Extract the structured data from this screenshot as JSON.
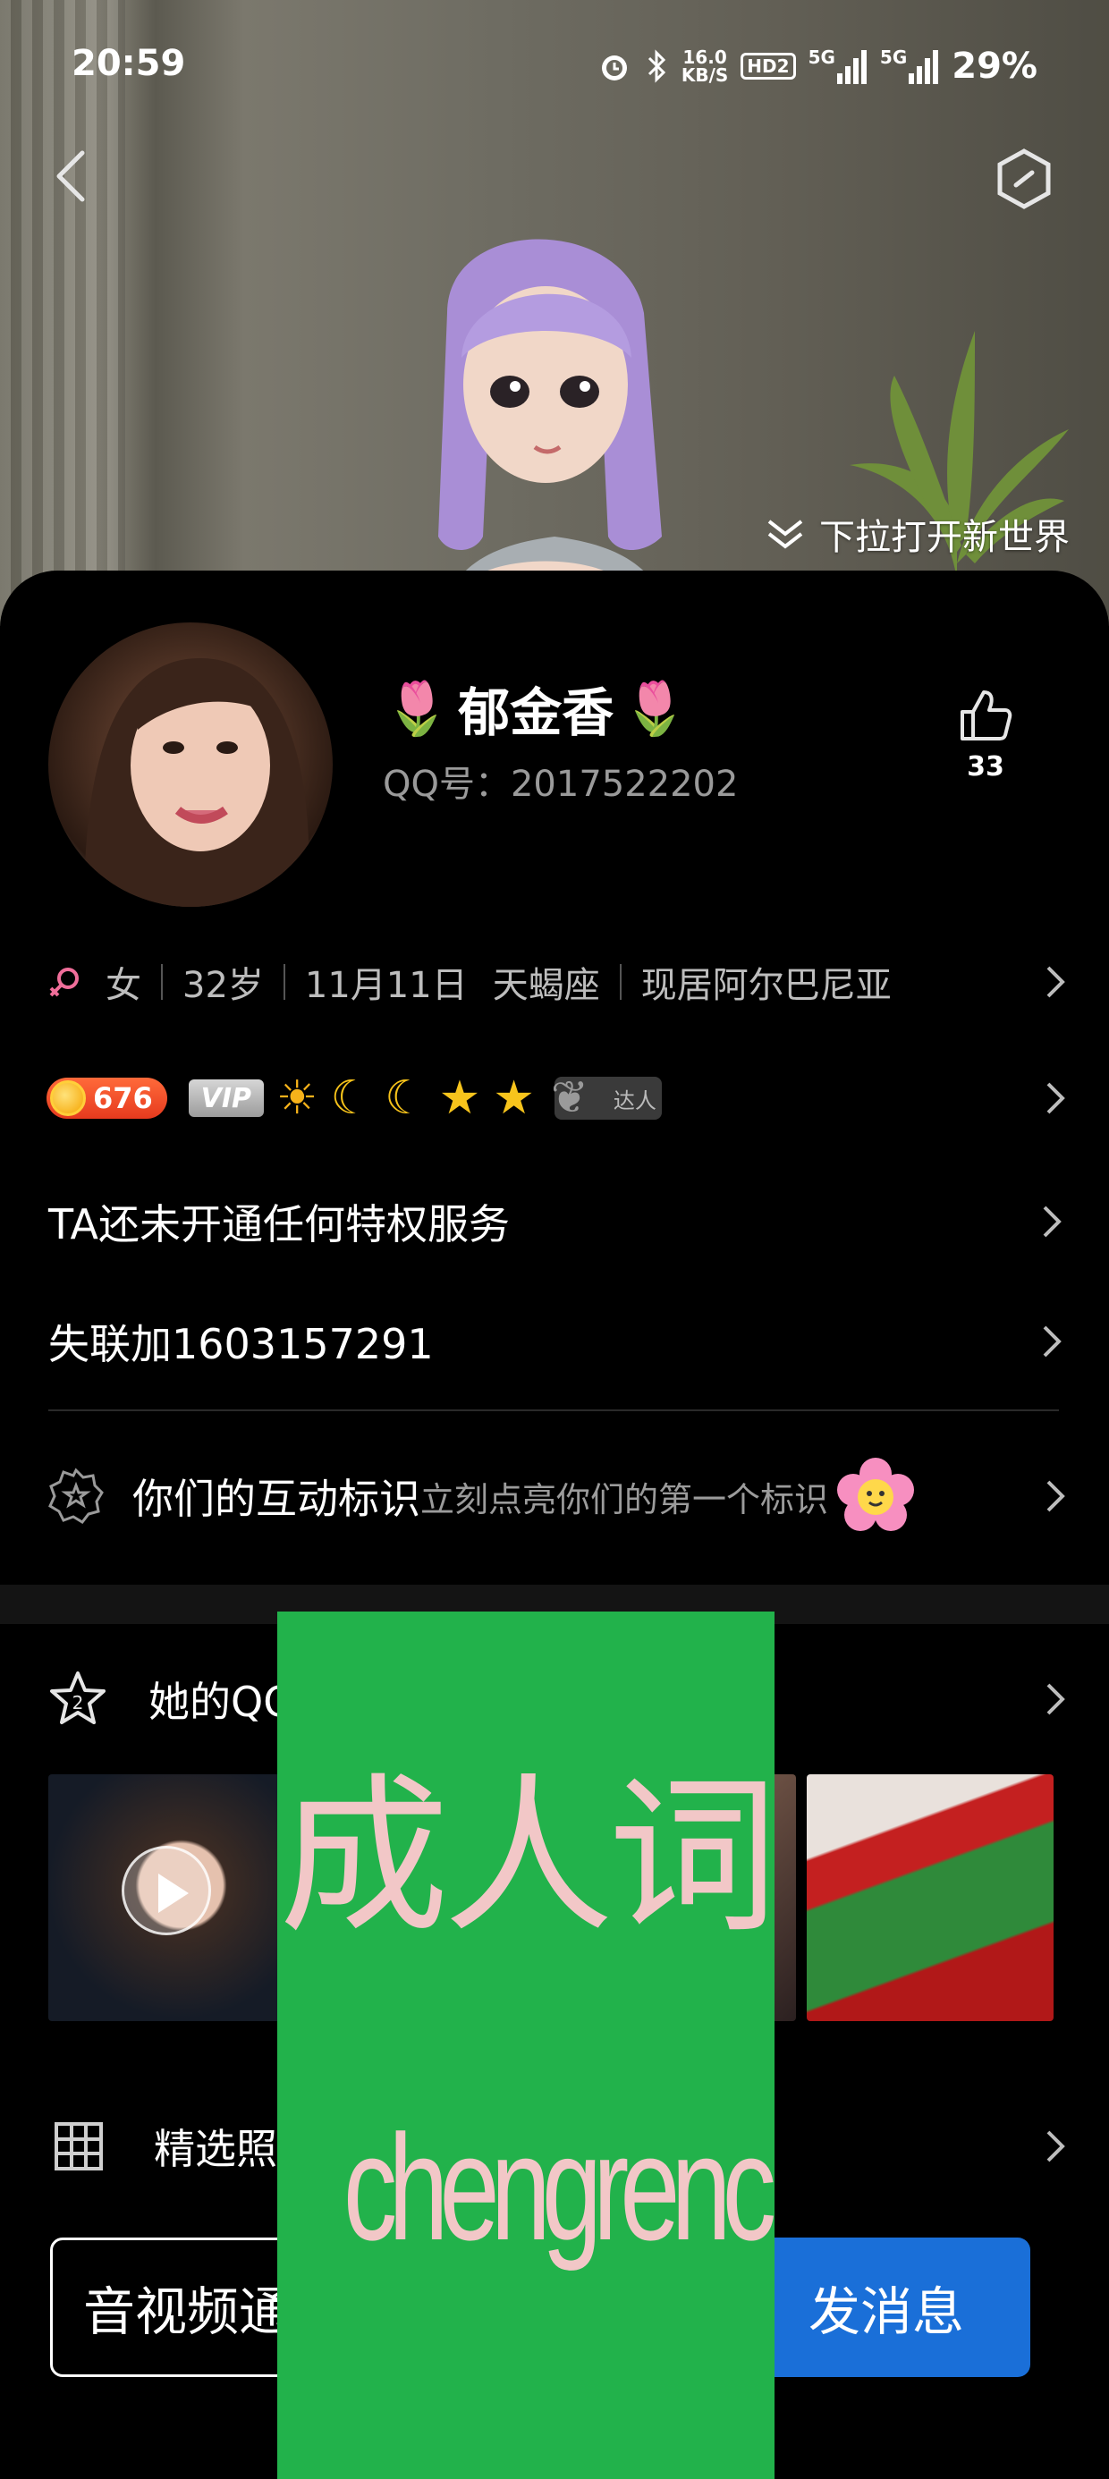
{
  "status_bar": {
    "time": "20:59",
    "net_speed_top": "16.0",
    "net_speed_unit": "KB/S",
    "hd": "HD2",
    "signal1": "5G",
    "signal2": "5G",
    "battery": "29%"
  },
  "hero": {
    "pull_hint": "下拉打开新世界"
  },
  "profile": {
    "name": "郁金香",
    "name_emoji": "🌷",
    "qq_label": "QQ号：2017522202",
    "likes": "33",
    "gender": "女",
    "age": "32岁",
    "birthday": "11月11日",
    "zodiac": "天蝎座",
    "location": "现居阿尔巴尼亚"
  },
  "badges": {
    "level": "676",
    "vip": "VIP",
    "daren": "达人"
  },
  "rows": {
    "privilege": "TA还未开通任何特权服务",
    "lost_contact": "失联加1603157291",
    "interact_title": "你们的互动标识",
    "interact_sub": "立刻点亮你们的第一个标识",
    "album": "她的QQ",
    "selected": "精选照"
  },
  "actions": {
    "call": "音视频通",
    "message": "发消息"
  },
  "watermark": {
    "line1": "成人词",
    "line2": "chengrenci.com"
  },
  "colors": {
    "accent_blue": "#1a6fd8",
    "watermark_green": "#22b24b",
    "level_orange": "#e63a1e"
  }
}
